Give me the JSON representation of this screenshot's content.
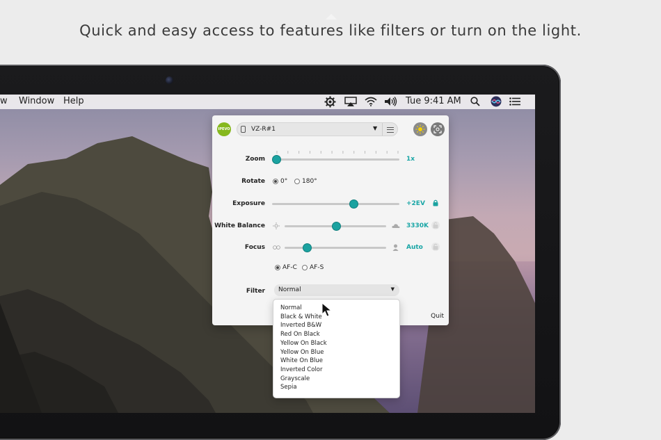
{
  "headline": "Quick and easy access to features like filters or turn on the light.",
  "menubar": {
    "left_items": [
      "w",
      "Window",
      "Help"
    ],
    "time": "Tue 9:41 AM",
    "icons": [
      "ipevo-gear-icon",
      "airplay-icon",
      "wifi-icon",
      "volume-icon",
      "search-icon",
      "siri-icon",
      "notification-center-icon"
    ]
  },
  "panel": {
    "logo_text": "IPEVO",
    "device_name": "VZ-R#1",
    "zoom": {
      "label": "Zoom",
      "value_text": "1x",
      "level": 0.0
    },
    "rotate": {
      "label": "Rotate",
      "options": [
        "0°",
        "180°"
      ],
      "selected": "0°"
    },
    "exposure": {
      "label": "Exposure",
      "value_text": "+2EV",
      "level": 0.64
    },
    "white_balance": {
      "label": "White Balance",
      "value_text": "3330K",
      "level": 0.51
    },
    "focus": {
      "label": "Focus",
      "value_text": "Auto",
      "level": 0.22,
      "modes": [
        "AF-C",
        "AF-S"
      ],
      "selected_mode": "AF-C"
    },
    "filter": {
      "label": "Filter",
      "selected": "Normal"
    },
    "quit_label": "Quit"
  },
  "filter_options": [
    "Normal",
    "Black & White",
    "Inverted B&W",
    "Red On Black",
    "Yellow On Black",
    "Yellow On Blue",
    "White On Blue",
    "Inverted Color",
    "Grayscale",
    "Sepia"
  ],
  "colors": {
    "accent": "#1ba2a0",
    "logo": "#86b81e"
  }
}
